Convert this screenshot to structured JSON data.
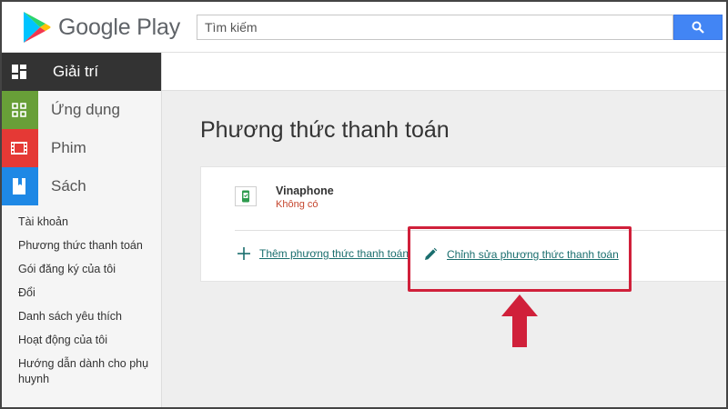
{
  "app": {
    "brand": "Google Play"
  },
  "search": {
    "placeholder": "Tìm kiếm"
  },
  "sidebar": {
    "categories": [
      {
        "label": "Giải trí",
        "color": "#333333"
      },
      {
        "label": "Ứng dụng",
        "color": "#689f38"
      },
      {
        "label": "Phim",
        "color": "#e53935"
      },
      {
        "label": "Sách",
        "color": "#1e88e5"
      }
    ],
    "links": [
      "Tài khoản",
      "Phương thức thanh toán",
      "Gói đăng ký của tôi",
      "Đổi",
      "Danh sách yêu thích",
      "Hoạt động của tôi",
      "Hướng dẫn dành cho phụ huynh"
    ]
  },
  "main": {
    "title": "Phương thức thanh toán",
    "payment_method": {
      "name": "Vinaphone",
      "status": "Không có",
      "status_color": "#c5452d",
      "icon": "phone-wallet-icon"
    },
    "actions": {
      "add_label": "Thêm phương thức thanh toán",
      "edit_label": "Chỉnh sửa phương thức thanh toán"
    }
  },
  "annotation": {
    "highlight_color": "#d0203a"
  }
}
